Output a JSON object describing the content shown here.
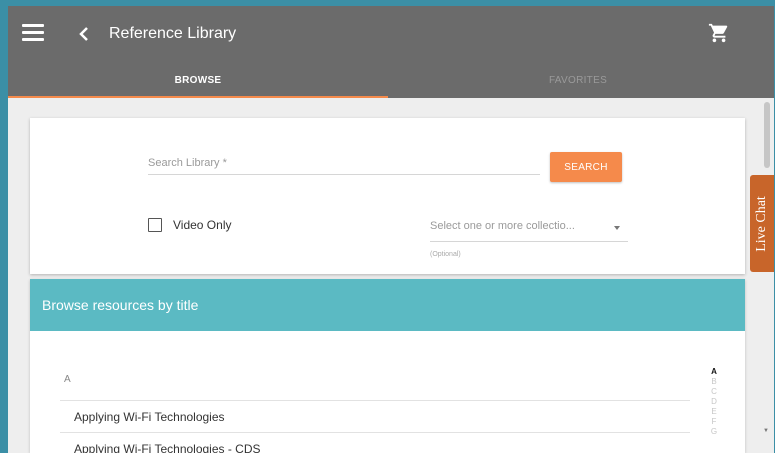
{
  "header": {
    "title": "Reference Library",
    "menu_icon": "hamburger-menu-icon",
    "back_icon": "chevron-left-icon",
    "cart_icon": "shopping-cart-icon"
  },
  "tabs": [
    {
      "label": "BROWSE",
      "active": true
    },
    {
      "label": "FAVORITES",
      "active": false
    }
  ],
  "search": {
    "placeholder": "Search Library *",
    "button_label": "SEARCH",
    "video_only_label": "Video Only",
    "video_only_checked": false,
    "collections_placeholder": "Select one or more collectio...",
    "collections_hint": "(Optional)"
  },
  "live_chat": {
    "label": "Live Chat"
  },
  "browse": {
    "header": "Browse resources by title",
    "current_letter": "A",
    "items": [
      "Applying Wi-Fi Technologies",
      "Applying Wi-Fi Technologies - CDS"
    ],
    "az_index": [
      "A",
      "B",
      "C",
      "D",
      "E",
      "F",
      "G"
    ]
  },
  "colors": {
    "appbar": "#6b6b6b",
    "accent": "#f58a4b",
    "browse_header": "#5bbac3",
    "live_chat": "#c8652a",
    "frame_border": "#3b8fa6"
  }
}
